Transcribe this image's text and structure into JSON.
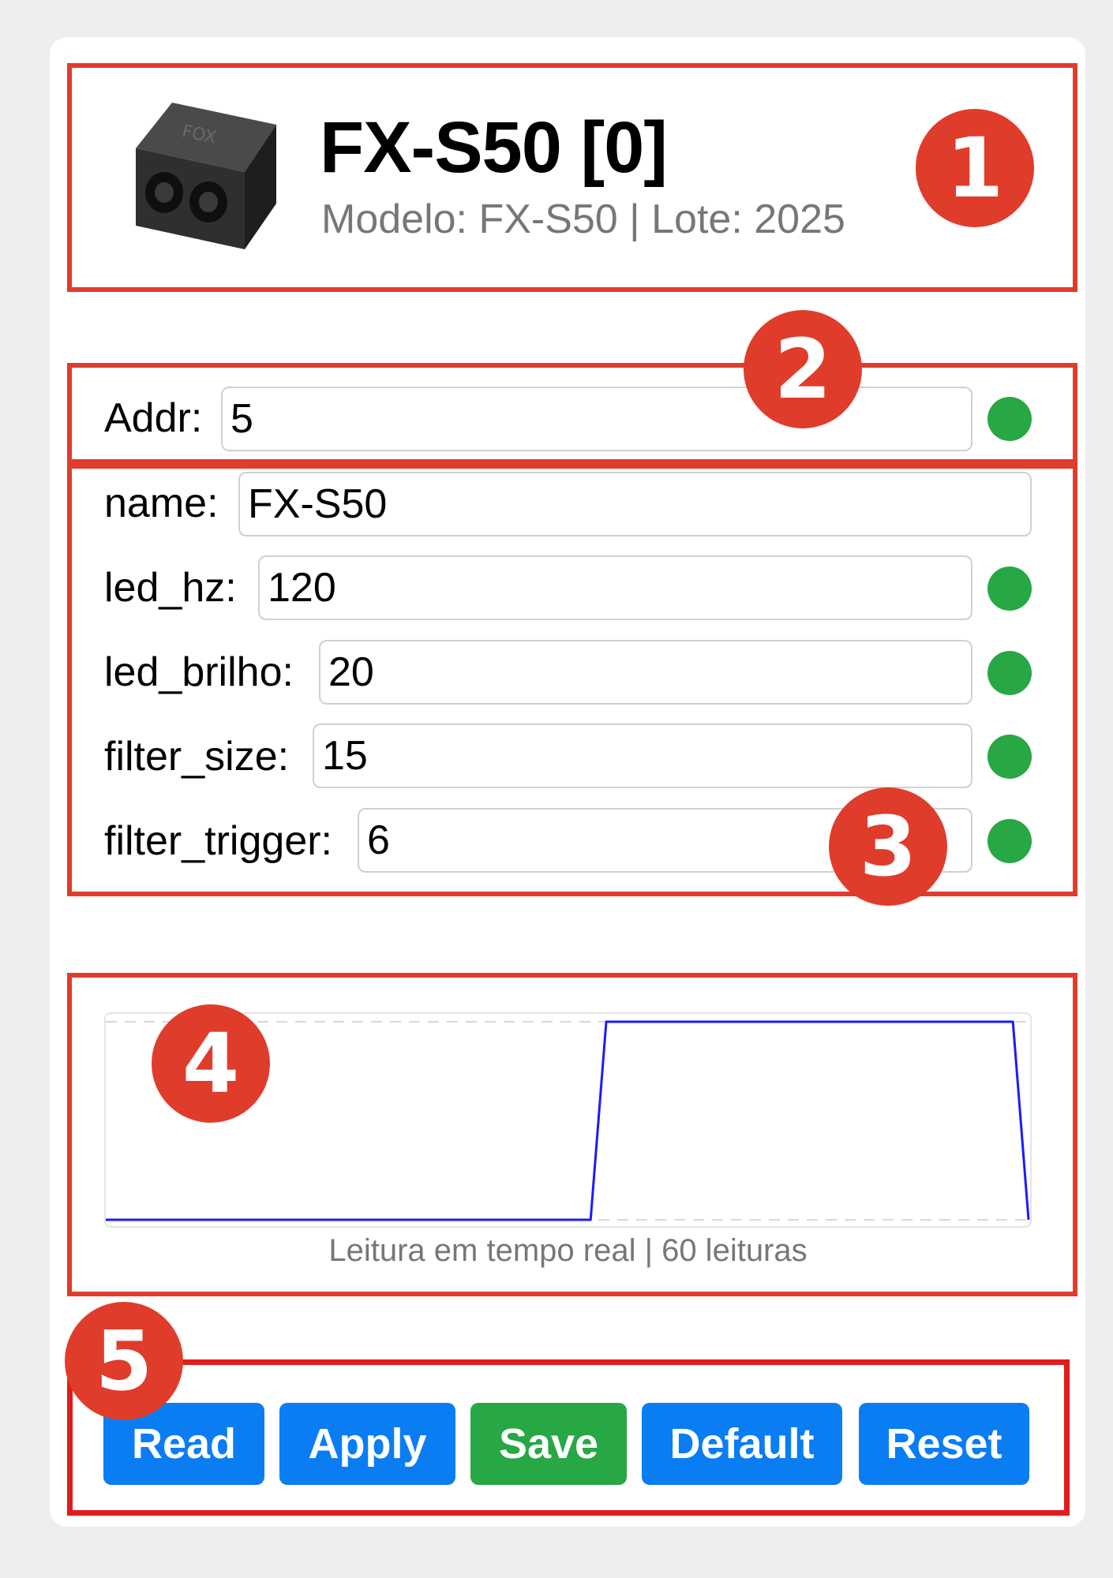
{
  "header": {
    "title": "FX-S50 [0]",
    "subtitle": "Modelo: FX-S50 | Lote: 2025",
    "device_logo_text": "FOX"
  },
  "address": {
    "label": "Addr:",
    "value": "5",
    "status": "ok"
  },
  "params": [
    {
      "label": "name:",
      "value": "FX-S50"
    },
    {
      "label": "led_hz:",
      "value": "120",
      "status": "ok"
    },
    {
      "label": "led_brilho:",
      "value": "20",
      "status": "ok"
    },
    {
      "label": "filter_size:",
      "value": "15",
      "status": "ok"
    },
    {
      "label": "filter_trigger:",
      "value": "6",
      "status": "ok"
    }
  ],
  "chart": {
    "caption": "Leitura em tempo real | 60 leituras",
    "line_color": "#1a1aff"
  },
  "chart_data": {
    "type": "line",
    "x": [
      1,
      2,
      3,
      4,
      5,
      6,
      7,
      8,
      9,
      10,
      11,
      12,
      13,
      14,
      15,
      16,
      17,
      18,
      19,
      20,
      21,
      22,
      23,
      24,
      25,
      26,
      27,
      28,
      29,
      30,
      31,
      32,
      33,
      34,
      35,
      36,
      37,
      38,
      39,
      40,
      41,
      42,
      43,
      44,
      45,
      46,
      47,
      48,
      49,
      50,
      51,
      52,
      53,
      54,
      55,
      56,
      57,
      58,
      59,
      60
    ],
    "values": [
      0,
      0,
      0,
      0,
      0,
      0,
      0,
      0,
      0,
      0,
      0,
      0,
      0,
      0,
      0,
      0,
      0,
      0,
      0,
      0,
      0,
      0,
      0,
      0,
      0,
      0,
      0,
      0,
      0,
      0,
      0,
      0,
      1,
      1,
      1,
      1,
      1,
      1,
      1,
      1,
      1,
      1,
      1,
      1,
      1,
      1,
      1,
      1,
      1,
      1,
      1,
      1,
      1,
      1,
      1,
      1,
      1,
      1,
      1,
      0
    ],
    "ylim": [
      0,
      1
    ],
    "grid": "dashed-horizontal",
    "title": "",
    "xlabel": "",
    "ylabel": ""
  },
  "buttons": [
    {
      "label": "Read",
      "color": "#0a7df3"
    },
    {
      "label": "Apply",
      "color": "#0a7df3"
    },
    {
      "label": "Save",
      "color": "#28a745"
    },
    {
      "label": "Default",
      "color": "#0a7df3"
    },
    {
      "label": "Reset",
      "color": "#0a7df3"
    }
  ],
  "annotations": [
    "1",
    "2",
    "3",
    "4",
    "5"
  ],
  "colors": {
    "annotation": "#e03c2c",
    "status_ok": "#28a745",
    "primary": "#0a7df3"
  }
}
